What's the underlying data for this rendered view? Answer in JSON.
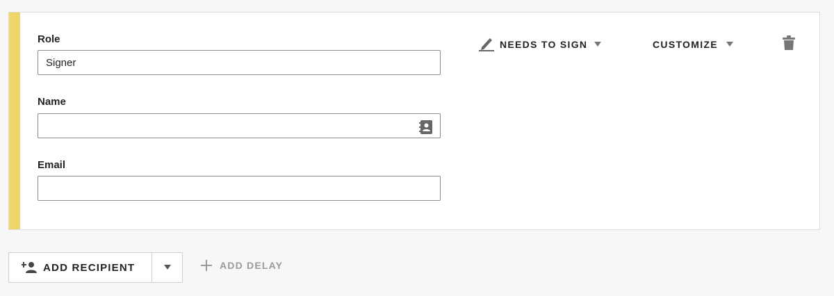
{
  "recipient": {
    "accent_color": "#f0d66a",
    "role": {
      "label": "Role",
      "value": "Signer",
      "placeholder": ""
    },
    "name": {
      "label": "Name",
      "value": "",
      "placeholder": ""
    },
    "email": {
      "label": "Email",
      "value": "",
      "placeholder": ""
    },
    "action": {
      "label": "NEEDS TO SIGN",
      "icon": "pen-icon"
    },
    "customize": {
      "label": "CUSTOMIZE"
    },
    "delete": {
      "icon": "trash-icon"
    }
  },
  "footer": {
    "add_recipient": {
      "label": "ADD RECIPIENT",
      "icon": "add-person-icon"
    },
    "add_delay": {
      "label": "ADD DELAY",
      "icon": "plus-icon"
    }
  }
}
